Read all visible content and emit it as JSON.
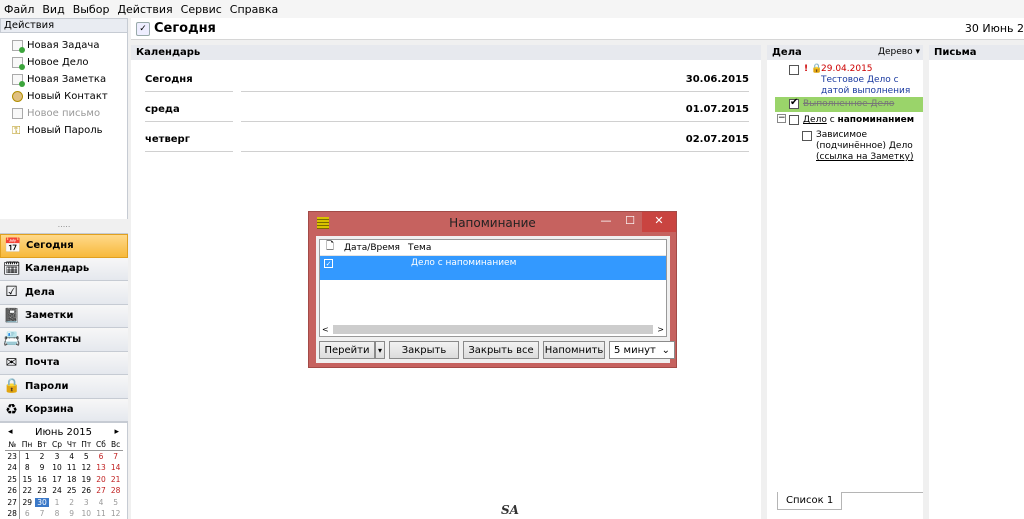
{
  "menu": [
    "Файл",
    "Вид",
    "Выбор",
    "Действия",
    "Сервис",
    "Справка"
  ],
  "actions": {
    "header": "Действия",
    "items": [
      {
        "label": "Новая Задача",
        "icon": "new-task-icon"
      },
      {
        "label": "Новое Дело",
        "icon": "new-todo-icon"
      },
      {
        "label": "Новая Заметка",
        "icon": "new-note-icon"
      },
      {
        "label": "Новый Контакт",
        "icon": "new-contact-icon"
      },
      {
        "label": "Новое письмо",
        "icon": "new-mail-icon"
      },
      {
        "label": "Новый Пароль",
        "icon": "key-icon"
      }
    ]
  },
  "nav": [
    {
      "label": "Сегодня",
      "icon": "today-icon"
    },
    {
      "label": "Календарь",
      "icon": "calendar-icon"
    },
    {
      "label": "Дела",
      "icon": "checklist-icon"
    },
    {
      "label": "Заметки",
      "icon": "notes-icon"
    },
    {
      "label": "Контакты",
      "icon": "contacts-icon"
    },
    {
      "label": "Почта",
      "icon": "mail-icon"
    },
    {
      "label": "Пароли",
      "icon": "lock-icon"
    },
    {
      "label": "Корзина",
      "icon": "recycle-icon"
    }
  ],
  "mini_calendar": {
    "month_label": "Июнь 2015",
    "prev": "◂",
    "next": "▸",
    "headers": [
      "№",
      "Пн",
      "Вт",
      "Ср",
      "Чт",
      "Пт",
      "Сб",
      "Вс"
    ],
    "weeks": [
      [
        "23",
        "1",
        "2",
        "3",
        "4",
        "5",
        "6",
        "7"
      ],
      [
        "24",
        "8",
        "9",
        "10",
        "11",
        "12",
        "13",
        "14"
      ],
      [
        "25",
        "15",
        "16",
        "17",
        "18",
        "19",
        "20",
        "21"
      ],
      [
        "26",
        "22",
        "23",
        "24",
        "25",
        "26",
        "27",
        "28"
      ],
      [
        "27",
        "29",
        "30",
        "1",
        "2",
        "3",
        "4",
        "5"
      ],
      [
        "28",
        "6",
        "7",
        "8",
        "9",
        "10",
        "11",
        "12"
      ]
    ]
  },
  "main": {
    "title": "Сегодня",
    "date": "30 Июнь 2",
    "calendar_pane": {
      "title": "Календарь",
      "days": [
        {
          "name": "Сегодня",
          "date": "30.06.2015"
        },
        {
          "name": "среда",
          "date": "01.07.2015"
        },
        {
          "name": "четверг",
          "date": "02.07.2015"
        }
      ],
      "footer_logo": "SA"
    },
    "tasks_pane": {
      "title": "Дела",
      "view": "Дерево ▾",
      "items": {
        "t1_mark": "!",
        "t1_date": "29.04.2015",
        "t1_line1": "Тестовое Дело с",
        "t1_line2": "датой выполнения",
        "t2": "Выполненное Дело",
        "t3_a": "Дело",
        "t3_b": " с ",
        "t3_c": "напоминанием",
        "t4_line1": "Зависимое",
        "t4_line2": "(подчинённое) Дело",
        "t4_line3": "(ссылка на Заметку)"
      },
      "tab": "Список 1"
    },
    "letters_pane": {
      "title": "Письма"
    }
  },
  "dialog": {
    "title": "Напоминание",
    "min": "—",
    "max": "☐",
    "close": "✕",
    "col_icon": "🗋",
    "col_datetime": "Дата/Время",
    "col_subject": "Тема",
    "row_subject": "Дело с напоминанием",
    "scroll_left": "<",
    "scroll_right": ">",
    "buttons": {
      "goto": "Перейти",
      "goto_arrow": "▾",
      "close": "Закрыть",
      "close_all": "Закрыть все",
      "remind": "Напомнить",
      "interval": "5 минут",
      "interval_arrow": "⌄"
    }
  }
}
